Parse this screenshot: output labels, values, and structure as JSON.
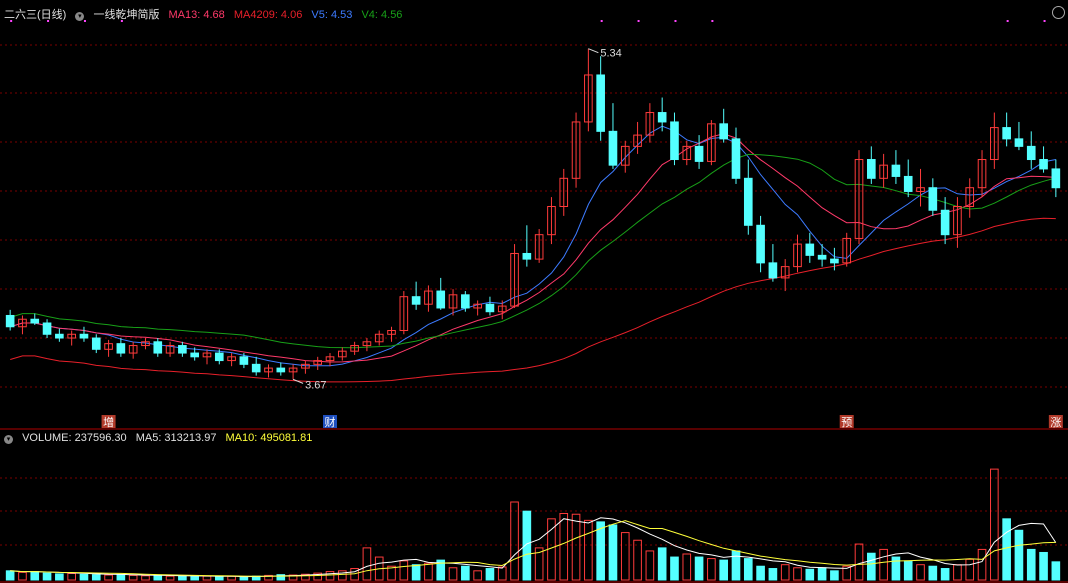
{
  "header": {
    "stock": "二六三",
    "period": "(日线)",
    "indicator": "一线乾坤简版",
    "ma13": "MA13: 4.68",
    "ma4209": "MA4209: 4.06",
    "v5": "V5: 4.53",
    "v4": "V4: 4.56"
  },
  "volume_header": {
    "volume": "VOLUME: 237596.30",
    "ma5": "MA5: 313213.97",
    "ma10": "MA10: 495081.81"
  },
  "annotations": {
    "high_label": "5.34",
    "low_label": "3.67"
  },
  "markers": [
    {
      "label": "增",
      "color": "#b13a2a"
    },
    {
      "label": "财",
      "color": "#1e4fbf"
    },
    {
      "label": "预",
      "color": "#b13a2a"
    },
    {
      "label": "涨",
      "color": "#b13a2a"
    }
  ],
  "colors": {
    "bg": "#000000",
    "up": "#ff3b3b",
    "down": "#54ffff",
    "ma13": "#ff3a6a",
    "ma4209": "#e8202a",
    "v5": "#3d7bff",
    "v4": "#18a018",
    "ma5": "#ffffff",
    "ma10": "#ffff3a",
    "grid": "#7a0000",
    "dots": "#ff44ff"
  },
  "chart_data": {
    "type": "candlestick",
    "ohlc_range": [
      3.55,
      5.45
    ],
    "candles": [
      [
        3.92,
        3.95,
        3.84,
        3.86
      ],
      [
        3.86,
        3.92,
        3.82,
        3.9
      ],
      [
        3.9,
        3.93,
        3.87,
        3.88
      ],
      [
        3.88,
        3.9,
        3.8,
        3.82
      ],
      [
        3.82,
        3.85,
        3.78,
        3.8
      ],
      [
        3.8,
        3.84,
        3.76,
        3.82
      ],
      [
        3.82,
        3.86,
        3.78,
        3.8
      ],
      [
        3.8,
        3.82,
        3.72,
        3.74
      ],
      [
        3.74,
        3.79,
        3.7,
        3.77
      ],
      [
        3.77,
        3.8,
        3.7,
        3.72
      ],
      [
        3.72,
        3.78,
        3.69,
        3.76
      ],
      [
        3.76,
        3.8,
        3.74,
        3.78
      ],
      [
        3.78,
        3.8,
        3.7,
        3.72
      ],
      [
        3.72,
        3.78,
        3.7,
        3.76
      ],
      [
        3.76,
        3.78,
        3.7,
        3.72
      ],
      [
        3.72,
        3.75,
        3.68,
        3.7
      ],
      [
        3.7,
        3.74,
        3.66,
        3.72
      ],
      [
        3.72,
        3.74,
        3.66,
        3.68
      ],
      [
        3.68,
        3.72,
        3.65,
        3.7
      ],
      [
        3.7,
        3.72,
        3.64,
        3.66
      ],
      [
        3.66,
        3.7,
        3.6,
        3.62
      ],
      [
        3.62,
        3.66,
        3.59,
        3.64
      ],
      [
        3.64,
        3.67,
        3.6,
        3.62
      ],
      [
        3.62,
        3.66,
        3.58,
        3.64
      ],
      [
        3.64,
        3.68,
        3.61,
        3.66
      ],
      [
        3.66,
        3.7,
        3.63,
        3.68
      ],
      [
        3.68,
        3.72,
        3.65,
        3.7
      ],
      [
        3.7,
        3.75,
        3.68,
        3.73
      ],
      [
        3.73,
        3.78,
        3.71,
        3.76
      ],
      [
        3.76,
        3.8,
        3.73,
        3.78
      ],
      [
        3.78,
        3.84,
        3.76,
        3.82
      ],
      [
        3.82,
        3.86,
        3.78,
        3.84
      ],
      [
        3.84,
        4.05,
        3.82,
        4.02
      ],
      [
        4.02,
        4.1,
        3.95,
        3.98
      ],
      [
        3.98,
        4.08,
        3.94,
        4.05
      ],
      [
        4.05,
        4.12,
        3.95,
        3.96
      ],
      [
        3.96,
        4.06,
        3.92,
        4.03
      ],
      [
        4.03,
        4.05,
        3.94,
        3.96
      ],
      [
        3.96,
        4.0,
        3.92,
        3.98
      ],
      [
        3.98,
        4.02,
        3.92,
        3.94
      ],
      [
        3.94,
        4.0,
        3.9,
        3.97
      ],
      [
        3.97,
        4.3,
        3.96,
        4.25
      ],
      [
        4.25,
        4.4,
        4.18,
        4.22
      ],
      [
        4.22,
        4.38,
        4.2,
        4.35
      ],
      [
        4.35,
        4.55,
        4.3,
        4.5
      ],
      [
        4.5,
        4.7,
        4.45,
        4.65
      ],
      [
        4.65,
        5.0,
        4.6,
        4.95
      ],
      [
        4.95,
        5.34,
        4.9,
        5.2
      ],
      [
        5.2,
        5.3,
        4.85,
        4.9
      ],
      [
        4.9,
        5.05,
        4.7,
        4.72
      ],
      [
        4.72,
        4.85,
        4.68,
        4.82
      ],
      [
        4.82,
        4.95,
        4.78,
        4.88
      ],
      [
        4.88,
        5.05,
        4.84,
        5.0
      ],
      [
        5.0,
        5.08,
        4.9,
        4.95
      ],
      [
        4.95,
        5.0,
        4.72,
        4.75
      ],
      [
        4.75,
        4.85,
        4.72,
        4.82
      ],
      [
        4.82,
        4.88,
        4.7,
        4.74
      ],
      [
        4.74,
        4.96,
        4.72,
        4.94
      ],
      [
        4.94,
        5.02,
        4.84,
        4.86
      ],
      [
        4.86,
        4.92,
        4.62,
        4.65
      ],
      [
        4.65,
        4.75,
        4.35,
        4.4
      ],
      [
        4.4,
        4.45,
        4.15,
        4.2
      ],
      [
        4.2,
        4.3,
        4.1,
        4.12
      ],
      [
        4.12,
        4.22,
        4.05,
        4.18
      ],
      [
        4.18,
        4.35,
        4.15,
        4.3
      ],
      [
        4.3,
        4.36,
        4.2,
        4.24
      ],
      [
        4.24,
        4.3,
        4.18,
        4.22
      ],
      [
        4.22,
        4.28,
        4.16,
        4.2
      ],
      [
        4.2,
        4.36,
        4.18,
        4.33
      ],
      [
        4.33,
        4.8,
        4.3,
        4.75
      ],
      [
        4.75,
        4.82,
        4.62,
        4.65
      ],
      [
        4.65,
        4.78,
        4.6,
        4.72
      ],
      [
        4.72,
        4.8,
        4.62,
        4.66
      ],
      [
        4.66,
        4.75,
        4.55,
        4.58
      ],
      [
        4.58,
        4.7,
        4.5,
        4.6
      ],
      [
        4.6,
        4.65,
        4.45,
        4.48
      ],
      [
        4.48,
        4.55,
        4.3,
        4.35
      ],
      [
        4.35,
        4.55,
        4.28,
        4.5
      ],
      [
        4.5,
        4.65,
        4.44,
        4.6
      ],
      [
        4.6,
        4.8,
        4.55,
        4.75
      ],
      [
        4.75,
        5.0,
        4.7,
        4.92
      ],
      [
        4.92,
        5.0,
        4.82,
        4.86
      ],
      [
        4.86,
        4.95,
        4.8,
        4.82
      ],
      [
        4.82,
        4.9,
        4.7,
        4.75
      ],
      [
        4.75,
        4.82,
        4.68,
        4.7
      ],
      [
        4.7,
        4.75,
        4.55,
        4.6
      ]
    ],
    "volume_range": [
      0,
      1700000
    ],
    "volume": [
      120000,
      100000,
      110000,
      90000,
      80000,
      85000,
      75000,
      70000,
      65000,
      70000,
      60000,
      55000,
      60000,
      50000,
      55000,
      45000,
      50000,
      42000,
      48000,
      40000,
      50000,
      60000,
      70000,
      65000,
      75000,
      90000,
      110000,
      120000,
      150000,
      420000,
      300000,
      180000,
      250000,
      200000,
      220000,
      260000,
      160000,
      180000,
      120000,
      150000,
      170000,
      1020000,
      900000,
      420000,
      800000,
      870000,
      860000,
      780000,
      760000,
      720000,
      620000,
      520000,
      380000,
      420000,
      300000,
      340000,
      300000,
      280000,
      260000,
      380000,
      280000,
      180000,
      150000,
      200000,
      160000,
      140000,
      160000,
      120000,
      180000,
      470000,
      350000,
      400000,
      300000,
      250000,
      200000,
      180000,
      150000,
      200000,
      270000,
      400000,
      1450000,
      800000,
      650000,
      400000,
      360000,
      237596
    ]
  }
}
